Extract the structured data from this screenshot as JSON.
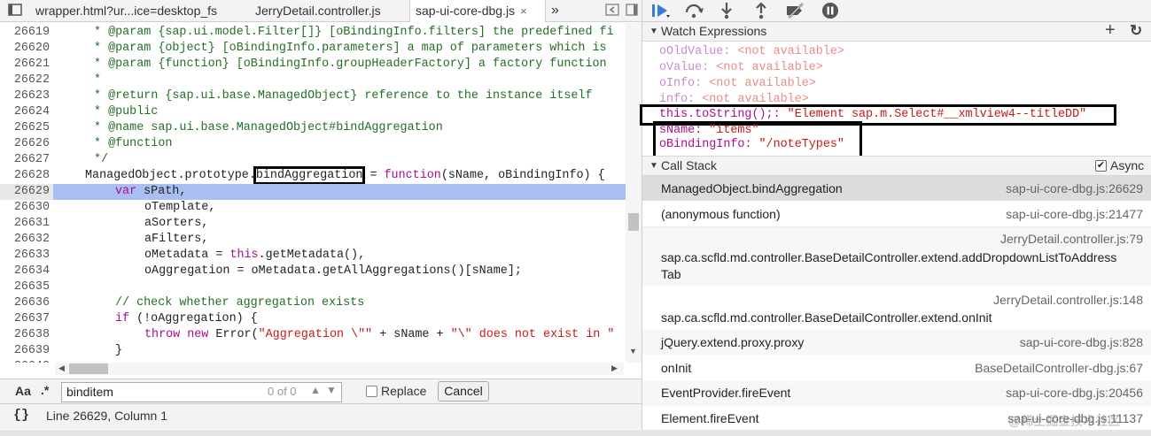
{
  "editor": {
    "tabs": [
      {
        "label": "wrapper.html?ur...ice=desktop_fs"
      },
      {
        "label": "JerryDetail.controller.js"
      },
      {
        "label": "sap-ui-core-dbg.js",
        "close": "×"
      }
    ],
    "more_tabs": "»",
    "lines": [
      {
        "num": "26619",
        "code": "* @param {sap.ui.model.Filter[]} [oBindingInfo.filters] the predefined fi"
      },
      {
        "num": "26620",
        "code": "* @param {object} [oBindingInfo.parameters] a map of parameters which is"
      },
      {
        "num": "26621",
        "code": "* @param {function} [oBindingInfo.groupHeaderFactory] a factory function"
      },
      {
        "num": "26622",
        "code": "*"
      },
      {
        "num": "26623",
        "code": "* @return {sap.ui.base.ManagedObject} reference to the instance itself"
      },
      {
        "num": "26624",
        "code": "* @public"
      },
      {
        "num": "26625",
        "code": "* @name sap.ui.base.ManagedObject#bindAggregation"
      },
      {
        "num": "26626",
        "code": "* @function"
      },
      {
        "num": "26627",
        "code": "*/"
      },
      {
        "num": "26628",
        "pre": "ManagedObject.prototype.",
        "box": "bindAggregation",
        "eq": " = ",
        "kw": "function",
        "post": "(sName, oBindingInfo) {"
      },
      {
        "num": "26629",
        "kw": "var",
        "post": " sPath,"
      },
      {
        "num": "26630",
        "post": "oTemplate,"
      },
      {
        "num": "26631",
        "post": "aSorters,"
      },
      {
        "num": "26632",
        "post": "aFilters,"
      },
      {
        "num": "26633",
        "pre": "oMetadata = ",
        "kw": "this",
        "post": ".getMetadata(),"
      },
      {
        "num": "26634",
        "post": "oAggregation = oMetadata.getAllAggregations()[sName];"
      },
      {
        "num": "26635",
        "post": ""
      },
      {
        "num": "26636",
        "code": "// check whether aggregation exists"
      },
      {
        "num": "26637",
        "kw": "if",
        "post": " (!oAggregation) {"
      },
      {
        "num": "26638",
        "kw": "throw",
        "kw2": "new",
        "pre2": " Error(",
        "s1": "\"Aggregation \\\"\"",
        "mid": " + sName + ",
        "s2": "\"\\\" does not exist in \""
      },
      {
        "num": "26639",
        "post": "}"
      },
      {
        "num": "26640",
        "post": ""
      }
    ],
    "search": {
      "case_label": "Aa",
      "regex_label": ".*",
      "value": "binditem",
      "count": "0 of 0",
      "replace_label": "Replace",
      "cancel_label": "Cancel"
    },
    "status": {
      "braces": "{}",
      "position": "Line 26629, Column 1"
    }
  },
  "watch": {
    "title": "Watch Expressions",
    "add": "+",
    "refresh": "↻",
    "items": [
      {
        "name": "oOldValue",
        "value": "<not available>"
      },
      {
        "name": "oValue",
        "value": "<not available>"
      },
      {
        "name": "oInfo",
        "value": "<not available>"
      },
      {
        "name": "info",
        "value": "<not available>"
      },
      {
        "name": "this.toString();",
        "value": "\"Element sap.m.Select#__xmlview4--titleDD\""
      },
      {
        "name": "sName",
        "value": "\"items\""
      },
      {
        "name": "oBindingInfo",
        "value": "\"/noteTypes\""
      }
    ]
  },
  "callstack": {
    "title": "Call Stack",
    "async_label": "Async",
    "frames": [
      {
        "fn": "ManagedObject.bindAggregation",
        "loc": "sap-ui-core-dbg.js:26629"
      },
      {
        "fn": "(anonymous function)",
        "loc": "sap-ui-core-dbg.js:21477"
      },
      {
        "fn": "sap.ca.scfld.md.controller.BaseDetailController.extend.addDropdownListToAddress",
        "fn2": "Tab",
        "loc": "JerryDetail.controller.js:79"
      },
      {
        "fn": "sap.ca.scfld.md.controller.BaseDetailController.extend.onInit",
        "loc": "JerryDetail.controller.js:148"
      },
      {
        "fn": "jQuery.extend.proxy.proxy",
        "loc": "sap-ui-core-dbg.js:828"
      },
      {
        "fn": "onInit",
        "loc": "BaseDetailController-dbg.js:67"
      },
      {
        "fn": "EventProvider.fireEvent",
        "loc": "sap-ui-core-dbg.js:20456"
      },
      {
        "fn": "Element.fireEvent",
        "loc": "sap-ui-core-dbg.js:11137"
      }
    ]
  },
  "watermark": "@稀土掘金技术社区",
  "colors": {
    "accent": "#3879d9",
    "highlight": "#a9bff2",
    "keyword": "#aa0d91",
    "string": "#c41a16",
    "comment": "#236e25"
  }
}
